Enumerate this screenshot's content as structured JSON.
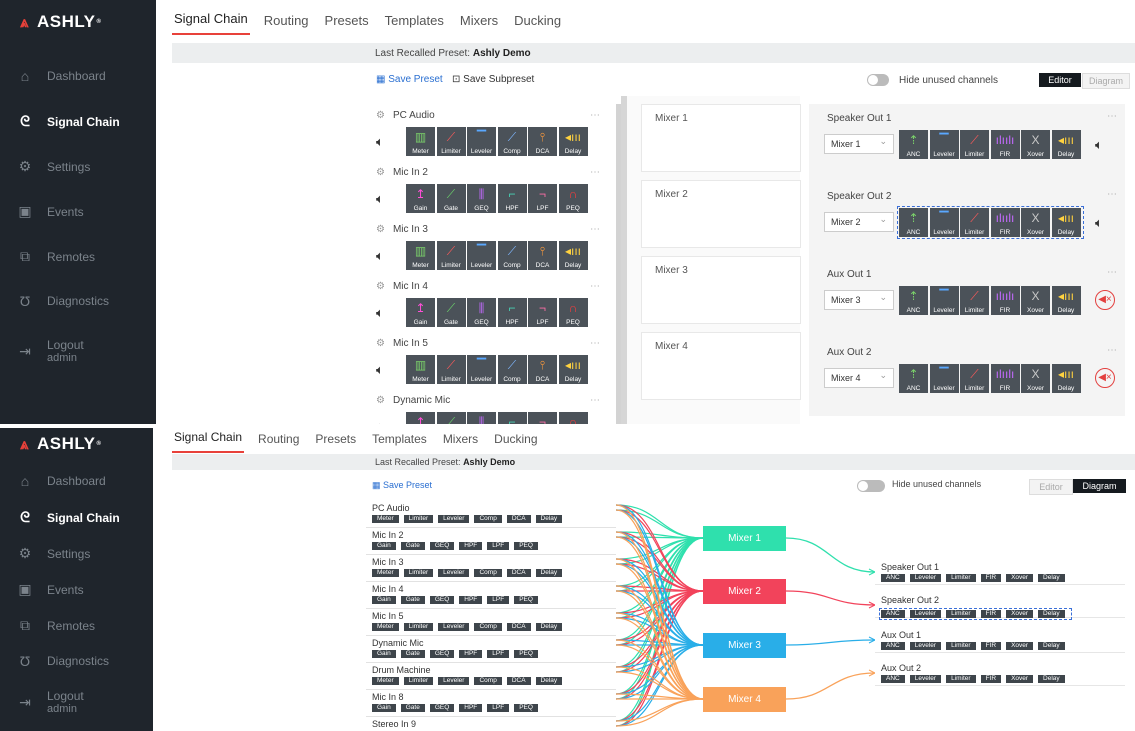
{
  "brand": {
    "logo": "ASHLY",
    "reg": "®"
  },
  "sidebar": {
    "items": [
      {
        "id": "dashboard",
        "label": "Dashboard",
        "icon": "home-icon",
        "glyph": "⌂"
      },
      {
        "id": "signal-chain",
        "label": "Signal Chain",
        "icon": "signal-chain-icon",
        "glyph": "ᘓ",
        "active": true
      },
      {
        "id": "settings",
        "label": "Settings",
        "icon": "gear-icon",
        "glyph": "⚙"
      },
      {
        "id": "events",
        "label": "Events",
        "icon": "calendar-icon",
        "glyph": "▣"
      },
      {
        "id": "remotes",
        "label": "Remotes",
        "icon": "remote-icon",
        "glyph": "⧉"
      },
      {
        "id": "diagnostics",
        "label": "Diagnostics",
        "icon": "stethoscope-icon",
        "glyph": "Ʊ"
      },
      {
        "id": "logout",
        "label": "Logout",
        "sub": "admin",
        "icon": "logout-icon",
        "glyph": "⇥"
      }
    ]
  },
  "tabs": [
    "Signal Chain",
    "Routing",
    "Presets",
    "Templates",
    "Mixers",
    "Ducking"
  ],
  "preset_bar": {
    "prefix": "Last Recalled Preset:",
    "name": "Ashly Demo"
  },
  "toolbar": {
    "save_preset": "Save Preset",
    "save_subpreset": "Save Subpreset",
    "hide_unused": "Hide unused channels",
    "editor": "Editor",
    "diagram": "Diagram"
  },
  "inputs": [
    {
      "name": "PC Audio",
      "blocks": [
        "Meter",
        "Limiter",
        "Leveler",
        "Comp",
        "DCA",
        "Delay"
      ]
    },
    {
      "name": "Mic In 2",
      "blocks": [
        "Gain",
        "Gate",
        "GEQ",
        "HPF",
        "LPF",
        "PEQ"
      ]
    },
    {
      "name": "Mic In 3",
      "blocks": [
        "Meter",
        "Limiter",
        "Leveler",
        "Comp",
        "DCA",
        "Delay"
      ]
    },
    {
      "name": "Mic In 4",
      "blocks": [
        "Gain",
        "Gate",
        "GEQ",
        "HPF",
        "LPF",
        "PEQ"
      ]
    },
    {
      "name": "Mic In 5",
      "blocks": [
        "Meter",
        "Limiter",
        "Leveler",
        "Comp",
        "DCA",
        "Delay"
      ]
    },
    {
      "name": "Dynamic Mic",
      "blocks": [
        "Gain",
        "Gate",
        "GEQ",
        "HPF",
        "LPF",
        "PEQ"
      ]
    },
    {
      "name": "Drum Machine",
      "blocks": [
        "Meter",
        "Limiter",
        "Leveler",
        "Comp",
        "DCA",
        "Delay"
      ]
    },
    {
      "name": "Mic In 8",
      "blocks": [
        "Gain",
        "Gate",
        "GEQ",
        "HPF",
        "LPF",
        "PEQ"
      ]
    },
    {
      "name": "Stereo In 9",
      "blocks": []
    }
  ],
  "mixers": [
    {
      "name": "Mixer 1",
      "color": "#2fe0ad"
    },
    {
      "name": "Mixer 2",
      "color": "#f2435b"
    },
    {
      "name": "Mixer 3",
      "color": "#29aee8"
    },
    {
      "name": "Mixer 4",
      "color": "#f9a25a"
    }
  ],
  "outputs": [
    {
      "name": "Speaker Out 1",
      "source": "Mixer 1",
      "blocks": [
        "ANC",
        "Leveler",
        "Limiter",
        "FIR",
        "Xover",
        "Delay"
      ],
      "muted": false
    },
    {
      "name": "Speaker Out 2",
      "source": "Mixer 2",
      "blocks": [
        "ANC",
        "Leveler",
        "Limiter",
        "FIR",
        "Xover",
        "Delay"
      ],
      "muted": false,
      "selected": true
    },
    {
      "name": "Aux Out 1",
      "source": "Mixer 3",
      "blocks": [
        "ANC",
        "Leveler",
        "Limiter",
        "FIR",
        "Xover",
        "Delay"
      ],
      "muted": true
    },
    {
      "name": "Aux Out 2",
      "source": "Mixer 4",
      "blocks": [
        "ANC",
        "Leveler",
        "Limiter",
        "FIR",
        "Xover",
        "Delay"
      ],
      "muted": true
    }
  ],
  "block_styles": {
    "Meter": {
      "glyph": "▥",
      "color": "#7bd36a"
    },
    "Limiter": {
      "glyph": "⟋",
      "color": "#ff5a5a"
    },
    "Leveler": {
      "glyph": "▔",
      "color": "#5aa8ff"
    },
    "Comp": {
      "glyph": "⟋",
      "color": "#7fb7ff"
    },
    "DCA": {
      "glyph": "⫯",
      "color": "#ff9b3b"
    },
    "Delay": {
      "glyph": "◂ııı",
      "color": "#ffd23f"
    },
    "Gain": {
      "glyph": "↥",
      "color": "#ff4fd8"
    },
    "Gate": {
      "glyph": "⟋",
      "color": "#6bd36b"
    },
    "GEQ": {
      "glyph": "⫼",
      "color": "#c46bff"
    },
    "HPF": {
      "glyph": "⌐",
      "color": "#48d1b4"
    },
    "LPF": {
      "glyph": "¬",
      "color": "#ff6fa7"
    },
    "PEQ": {
      "glyph": "∩",
      "color": "#ff3b3b"
    },
    "ANC": {
      "glyph": "⇡",
      "color": "#7bd36a"
    },
    "FIR": {
      "glyph": "ılıılı",
      "color": "#c46bff"
    },
    "Xover": {
      "glyph": "X",
      "color": "#c9c9c9"
    }
  },
  "icons": {
    "speaker": "speaker-icon",
    "mute": "mute-icon",
    "gear": "gear-icon",
    "more": "more-icon",
    "save": "save-icon",
    "subpreset": "subpreset-icon"
  }
}
